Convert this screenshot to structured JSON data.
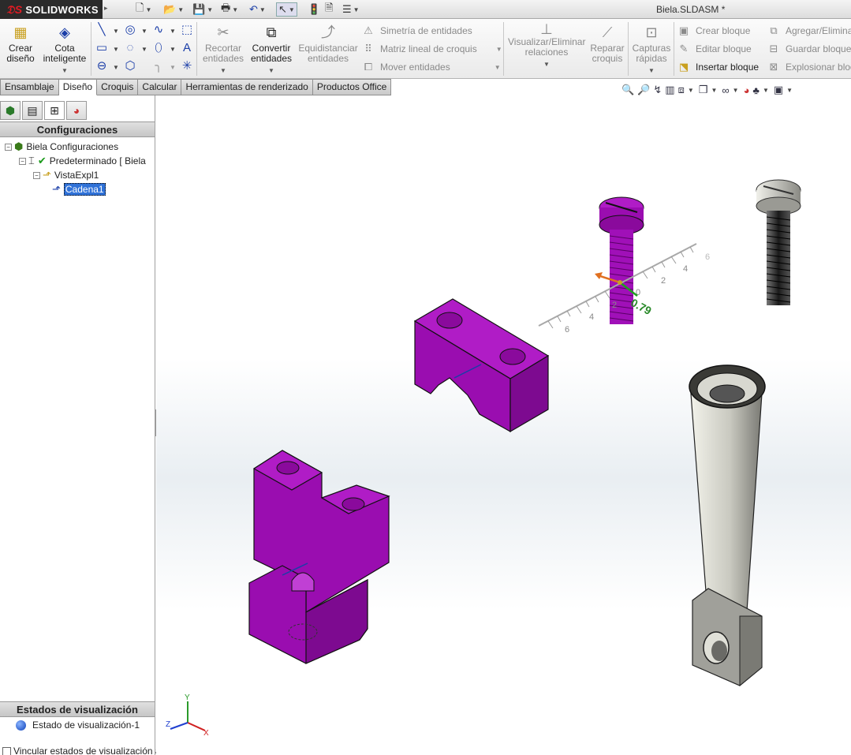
{
  "app": {
    "brand_ds": "𝔇S",
    "brand": "SOLIDWORKS",
    "document_title": "Biela.SLDASM *"
  },
  "ribbon": {
    "crear_diseno": "Crear\ndiseño",
    "cota_inteligente": "Cota\ninteligente",
    "recortar": "Recortar\nentidades",
    "convertir": "Convertir\nentidades",
    "equidistanciar": "Equidistanciar\nentidades",
    "simetria": "Simetría de entidades",
    "matriz": "Matriz lineal de croquis",
    "mover": "Mover entidades",
    "visualizar": "Visualizar/Eliminar\nrelaciones",
    "reparar": "Reparar\ncroquis",
    "capturas": "Capturas\nrápidas",
    "crear_bloque": "Crear bloque",
    "editar_bloque": "Editar bloque",
    "insertar_bloque": "Insertar bloque",
    "agregar": "Agregar/Elimina",
    "guardar_bloque": "Guardar bloque",
    "explosionar": "Explosionar bloq"
  },
  "tabs": [
    "Ensamblaje",
    "Diseño",
    "Croquis",
    "Calcular",
    "Herramientas de renderizado",
    "Productos Office"
  ],
  "active_tab": "Diseño",
  "config_panel": {
    "title": "Configuraciones",
    "tree": [
      {
        "label": "Biela Configuraciones"
      },
      {
        "label": "Predeterminado [ Biela"
      },
      {
        "label": "VistaExpl1"
      },
      {
        "label": "Cadena1"
      }
    ],
    "states_title": "Estados de visualización",
    "display_state": "Estado de visualización-1",
    "link_label": "Vincular estados de visualización a"
  },
  "viewport": {
    "ruler_labels": [
      "6",
      "4",
      "2",
      "0",
      "2",
      "4",
      "6"
    ],
    "ruler_value": "0.79",
    "triad": {
      "x": "X",
      "y": "Y",
      "z": "Z"
    }
  },
  "colors": {
    "part_magenta": "#a010b8",
    "part_gray": "#d8d8d0",
    "selection_blue": "#3072d8"
  }
}
